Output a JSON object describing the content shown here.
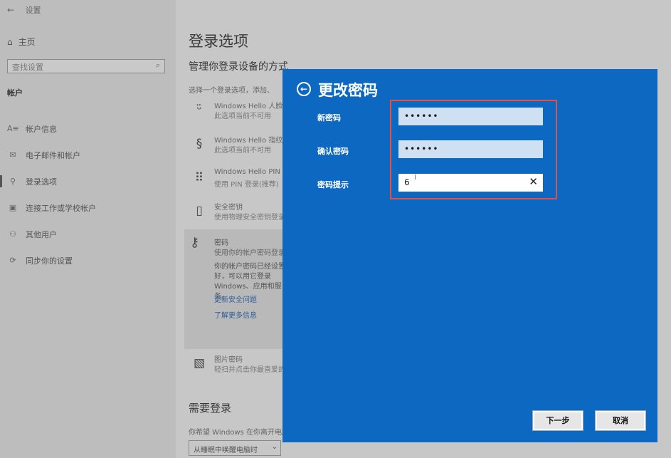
{
  "sidebar": {
    "back_icon": "←",
    "app_title": "设置",
    "home_label": "主页",
    "search_placeholder": "查找设置",
    "section_title": "帐户",
    "items": [
      {
        "label": "帐户信息",
        "icon": "person-card-icon"
      },
      {
        "label": "电子邮件和帐户",
        "icon": "mail-icon"
      },
      {
        "label": "登录选项",
        "icon": "key-icon",
        "active": true
      },
      {
        "label": "连接工作或学校帐户",
        "icon": "briefcase-icon"
      },
      {
        "label": "其他用户",
        "icon": "person-add-icon"
      },
      {
        "label": "同步你的设置",
        "icon": "sync-icon"
      }
    ]
  },
  "main": {
    "title": "登录选项",
    "subtitle": "管理你登录设备的方式",
    "desc": "选择一个登录选项，添加、",
    "options": [
      {
        "title": "Windows Hello 人脸",
        "sub": "此选项当前不可用",
        "icon": "face-icon"
      },
      {
        "title": "Windows Hello 指纹",
        "sub": "此选项当前不可用",
        "icon": "fingerprint-icon"
      },
      {
        "title": "Windows Hello PIN",
        "sub": "使用 PIN 登录(推荐)",
        "icon": "keypad-icon"
      },
      {
        "title": "安全密钥",
        "sub": "使用物理安全密钥登录",
        "icon": "usb-key-icon"
      }
    ],
    "password": {
      "title": "密码",
      "sub": "使用你的帐户密码登录",
      "note": "你的帐户密码已经设置好，可以用它登录Windows、应用和服务。",
      "link_1": "更新安全问题",
      "link_2": "了解更多信息"
    },
    "picture_password": {
      "title": "图片密码",
      "sub": "轻扫并点击你最喜爱的照片"
    },
    "need_login_title": "需要登录",
    "need_login_desc": "你希望 Windows 在你离开电脑多久",
    "need_login_value": "从睡眠中唤醒电脑时"
  },
  "dialog": {
    "title": "更改密码",
    "new_password_label": "新密码",
    "new_password_value": "••••••",
    "confirm_password_label": "确认密码",
    "confirm_password_value": "••••••",
    "hint_label": "密码提示",
    "hint_value": "6",
    "next_button": "下一步",
    "cancel_button": "取消"
  }
}
